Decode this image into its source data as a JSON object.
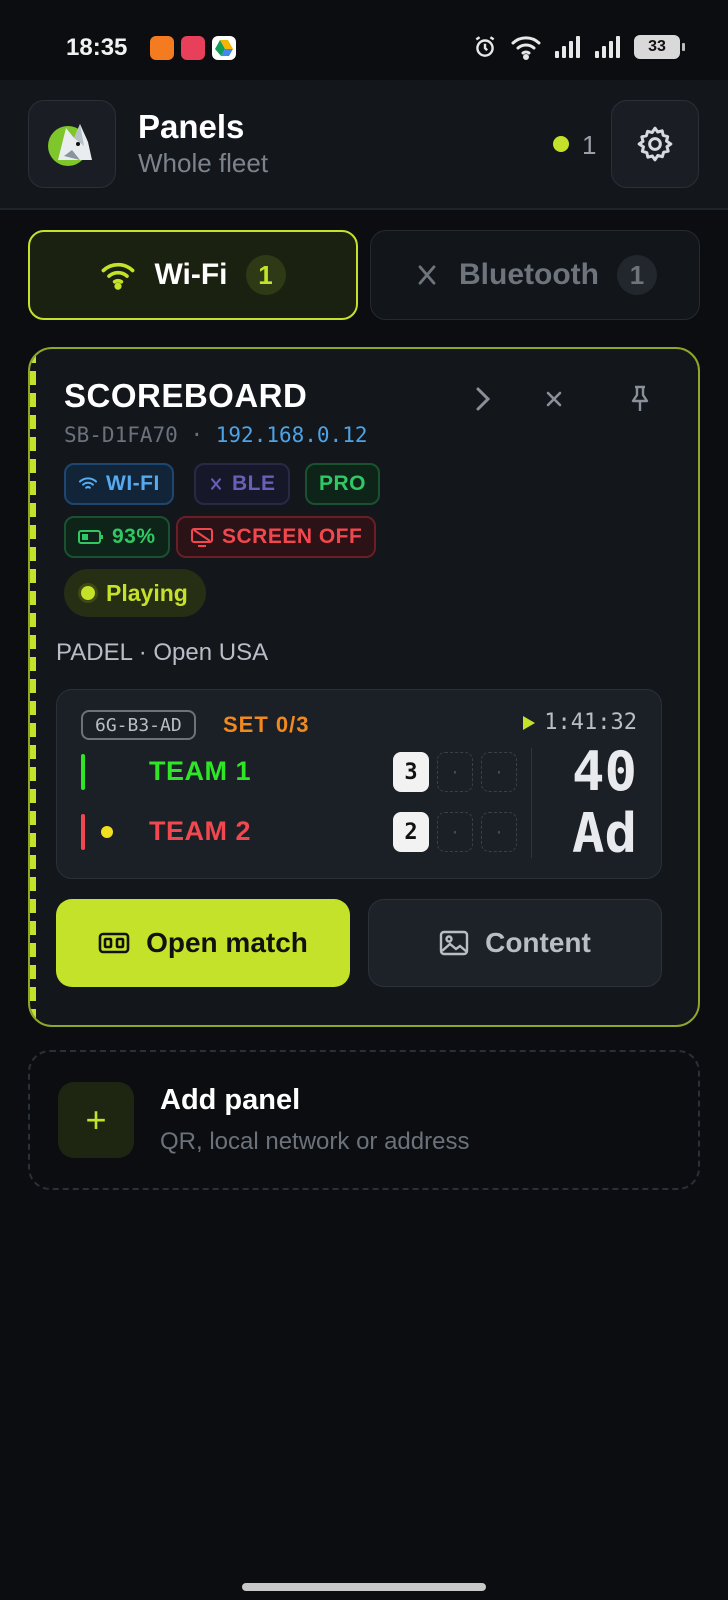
{
  "status_bar": {
    "time": "18:35",
    "battery": "33"
  },
  "header": {
    "title": "Panels",
    "subtitle": "Whole fleet",
    "online_count": "1",
    "accent": "#c5e22a"
  },
  "tabs": [
    {
      "label": "Wi-Fi",
      "count": "1",
      "icon": "wifi-icon",
      "selected": true
    },
    {
      "label": "Bluetooth",
      "count": "1",
      "icon": "bluetooth-icon",
      "selected": false
    }
  ],
  "panel": {
    "title": "SCOREBOARD",
    "device_id": "SB-D1FA70",
    "separator": "·",
    "ip": "192.168.0.12",
    "badges": {
      "wifi": "WI-FI",
      "ble": "BLE",
      "pro": "PRO",
      "battery": "93%",
      "screen": "SCREEN OFF"
    },
    "state": "Playing",
    "sport_line": "PADEL · Open USA",
    "match": {
      "court_code": "6G-B3-AD",
      "set_label": "SET 0/3",
      "timer": "1:41:32",
      "teams": [
        {
          "name": "TEAM 1",
          "color": "#2ee626",
          "sets": [
            "3",
            "·",
            "·"
          ],
          "points": "40",
          "serving": false
        },
        {
          "name": "TEAM 2",
          "color": "#f2474e",
          "sets": [
            "2",
            "·",
            "·"
          ],
          "points": "Ad",
          "serving": true
        }
      ]
    },
    "buttons": {
      "open_match": "Open match",
      "content": "Content"
    }
  },
  "add_panel": {
    "title": "Add panel",
    "subtitle": "QR, local network or address",
    "plus": "+"
  }
}
